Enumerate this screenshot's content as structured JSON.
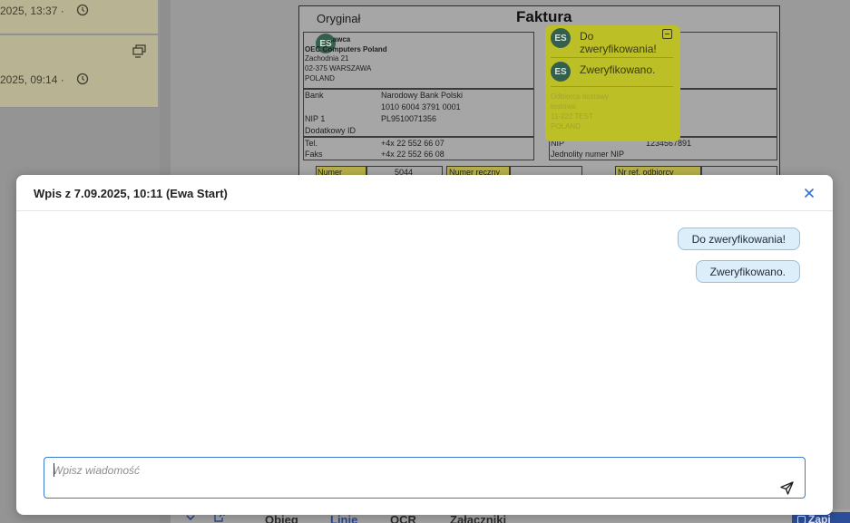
{
  "left_panel": {
    "items": [
      {
        "time": "2025, 13:37 ·",
        "clock_icon": "history-icon"
      },
      {
        "time": "2025, 09:14 ·",
        "clock_icon": "history-icon",
        "extra_icon": "monitor-icon"
      }
    ]
  },
  "document": {
    "original_label": "Oryginał",
    "title": "Faktura",
    "seller": {
      "heading": "...awca",
      "name": "OEC Computers Poland",
      "street": "Zachodnia 21",
      "city": "02-375 WARSZAWA",
      "country": "POLAND"
    },
    "bank": {
      "bank_label": "Bank",
      "bank_name": "Narodowy Bank Polski",
      "account": "1010 6004 3791 0001",
      "nip_label": "NIP 1",
      "nip_value": "PL9510071356",
      "extra_id_label": "Dodatkowy ID"
    },
    "contact": {
      "tel_label": "Tel.",
      "tel_value": "+4x 22 552 66 07",
      "fax_label": "Faks",
      "fax_value": "+4x 22 552 66 08"
    },
    "recipient": {
      "delivery_heading": "Odbiorca dostawy",
      "faint_lines": [
        "testowa",
        "11-222 TEST",
        "POLAND"
      ],
      "nip_label": "NIP",
      "nip_value": "1234567891",
      "unified_nip_label": "Jednolity numer NIP"
    },
    "fields_row": {
      "number_label": "Numer",
      "number_value": "5044",
      "manual_number_label": "Numer ręczny",
      "recipient_ref_label": "Nr ref. odbiorcy"
    },
    "colors": {
      "highlight": "#bcbf25",
      "avatar": "#345f4c"
    }
  },
  "note": {
    "entries": [
      {
        "avatar": "ES",
        "text": "Do zweryfikowania!"
      },
      {
        "avatar": "ES",
        "text": "Zweryfikowano."
      }
    ],
    "collapse_icon": "minus-square-icon"
  },
  "bottom_tabs": {
    "collapse_icon": "chevron-down-icon",
    "external_icon": "external-link-icon",
    "tabs": [
      "Obieg",
      "Linie",
      "OCR",
      "Załączniki"
    ],
    "save_label": "Zapi"
  },
  "modal": {
    "title": "Wpis z 7.09.2025, 10:11 (Ewa Start)",
    "close_icon": "close-icon",
    "messages": [
      "Do zweryfikowania!",
      "Zweryfikowano."
    ],
    "input_placeholder": "Wpisz wiadomość",
    "input_value": "",
    "send_icon": "send-icon",
    "colors": {
      "bubble_bg": "#ddeefb",
      "bubble_border": "#8ec1ec",
      "accent": "#3b7bd0"
    }
  }
}
